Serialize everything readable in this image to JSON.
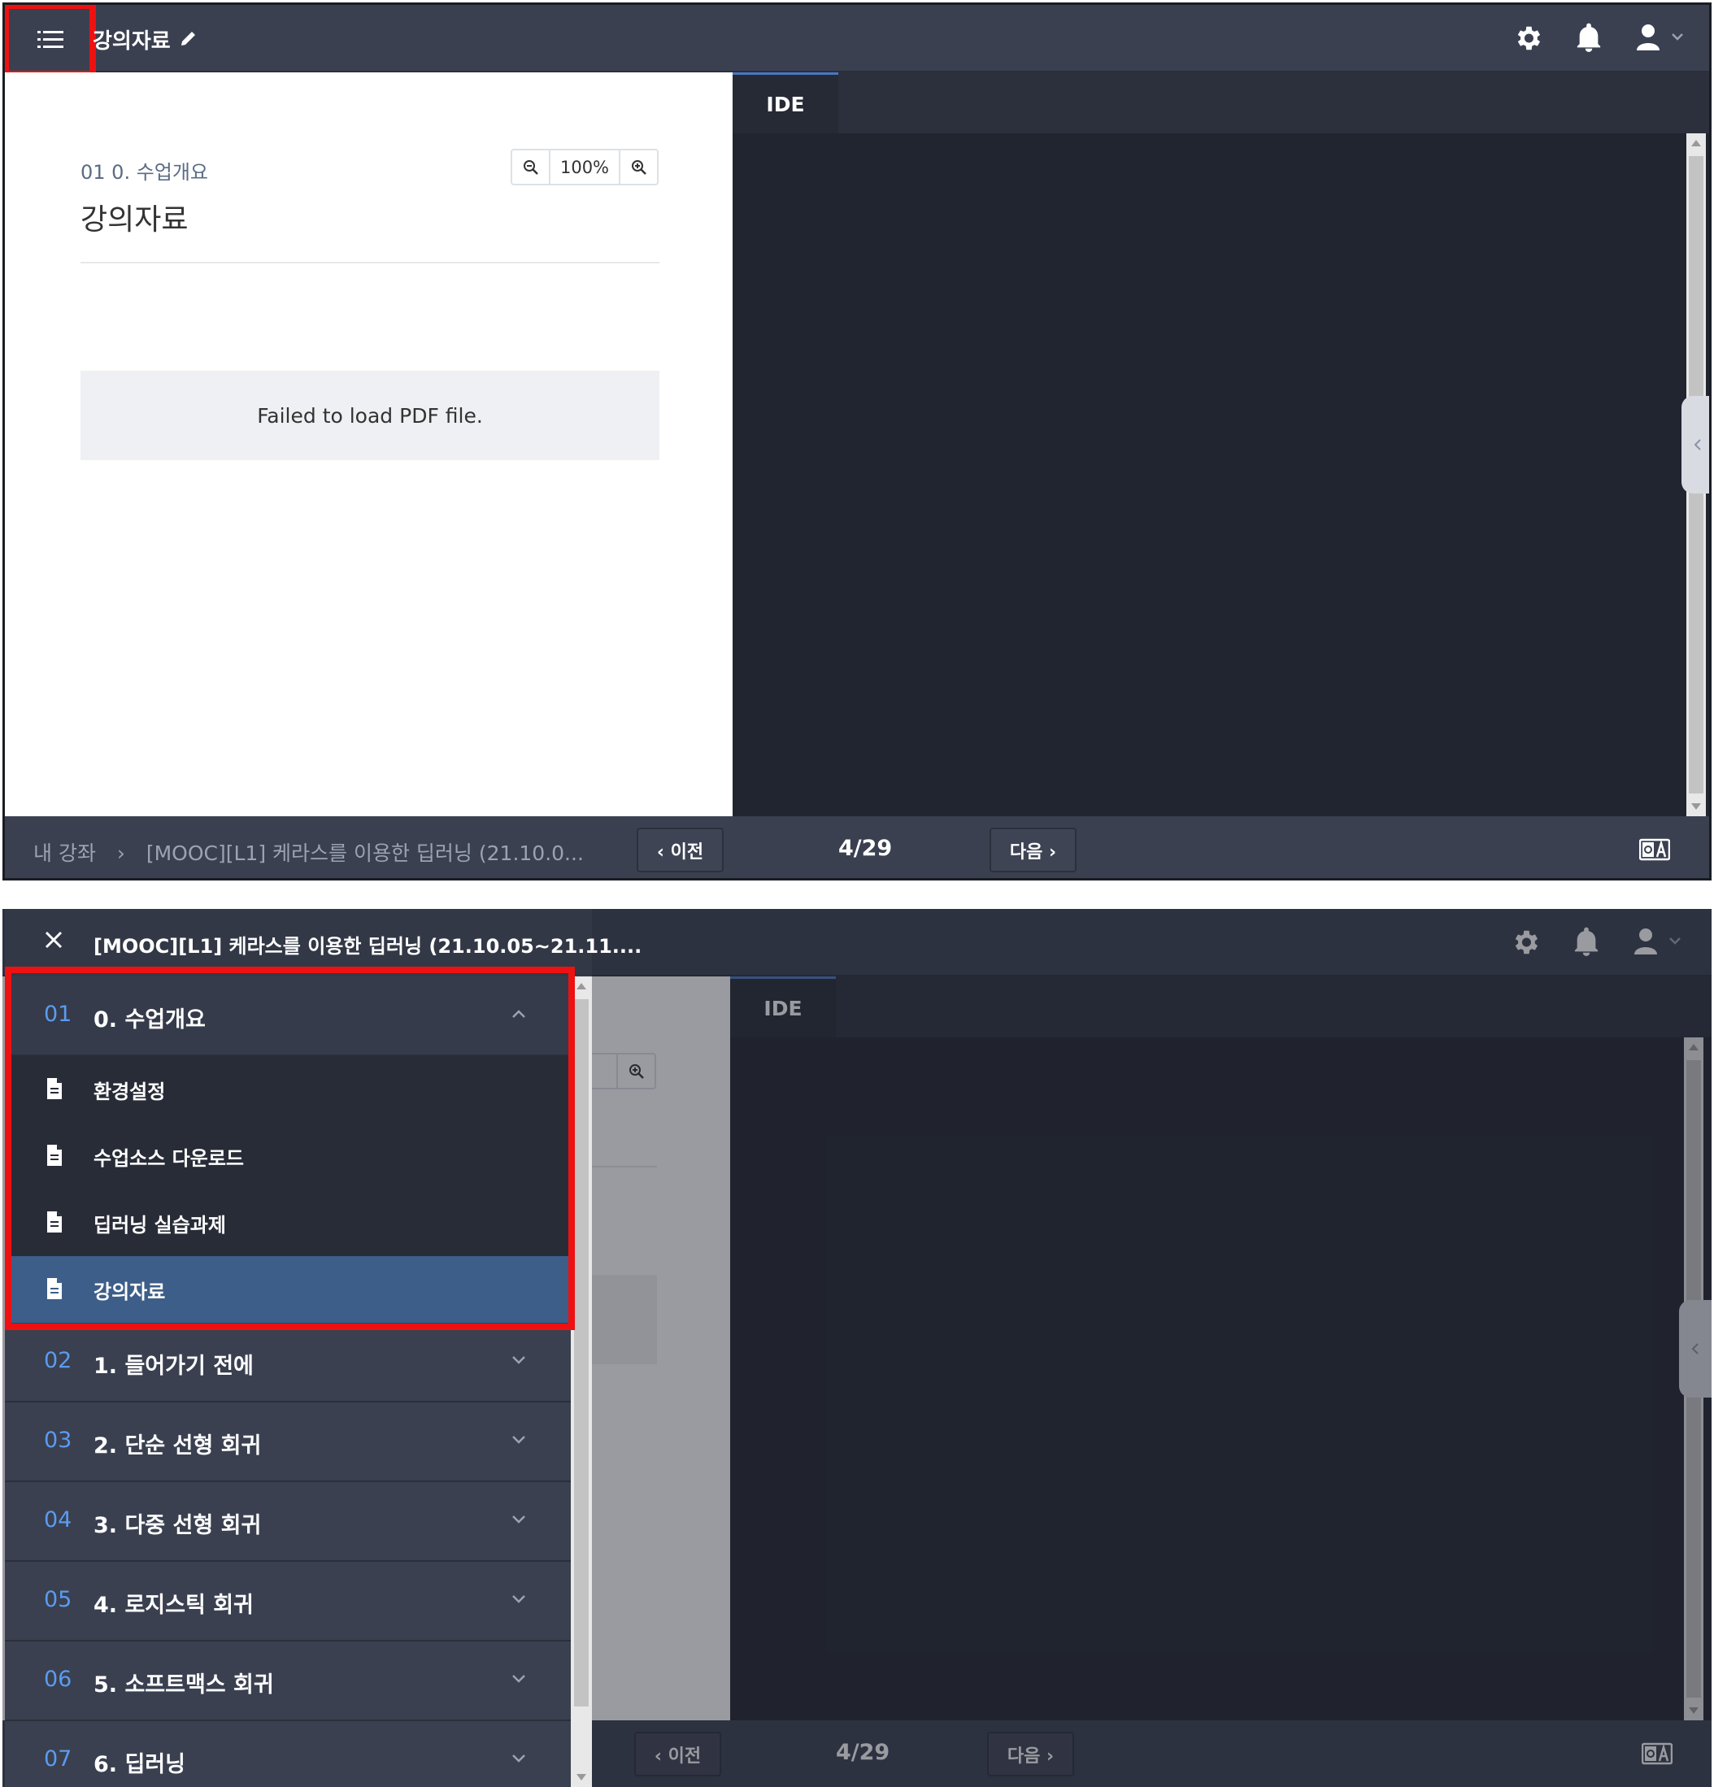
{
  "top": {
    "header": {
      "title": "강의자료"
    },
    "doc": {
      "breadcrumb": "01 0. 수업개요",
      "title": "강의자료",
      "zoom": "100%",
      "error": "Failed to load PDF file."
    },
    "ide": {
      "tab": "IDE"
    },
    "footer": {
      "crumb_home": "내 강좌",
      "crumb_sep": "›",
      "crumb_course": "[MOOC][L1] 케라스를 이용한 딥러닝 (21.10.0...",
      "prev": "‹ 이전",
      "page": "4/29",
      "next": "다음 ›"
    }
  },
  "bottom": {
    "drawer": {
      "title": "[MOOC][L1] 케라스를 이용한 딥러닝 (21.10.05~21.11....",
      "open_section": {
        "num": "01",
        "label": "0. 수업개요"
      },
      "items": [
        {
          "label": "환경설정"
        },
        {
          "label": "수업소스 다운로드"
        },
        {
          "label": "딥러닝 실습과제"
        },
        {
          "label": "강의자료"
        }
      ],
      "sections": [
        {
          "num": "02",
          "label": "1. 들어가기 전에"
        },
        {
          "num": "03",
          "label": "2. 단순 선형 회귀"
        },
        {
          "num": "04",
          "label": "3. 다중 선형 회귀"
        },
        {
          "num": "05",
          "label": "4. 로지스틱 회귀"
        },
        {
          "num": "06",
          "label": "5. 소프트맥스 회귀"
        },
        {
          "num": "07",
          "label": "6. 딥러닝"
        }
      ]
    },
    "zoom_partial": "%",
    "ide": {
      "tab": "IDE"
    },
    "footer": {
      "prev": "‹ 이전",
      "page": "4/29",
      "next": "다음 ›"
    }
  },
  "colors": {
    "accent": "#5b9bf0",
    "highlight": "#ee1111",
    "active_item": "#3d5e88"
  }
}
